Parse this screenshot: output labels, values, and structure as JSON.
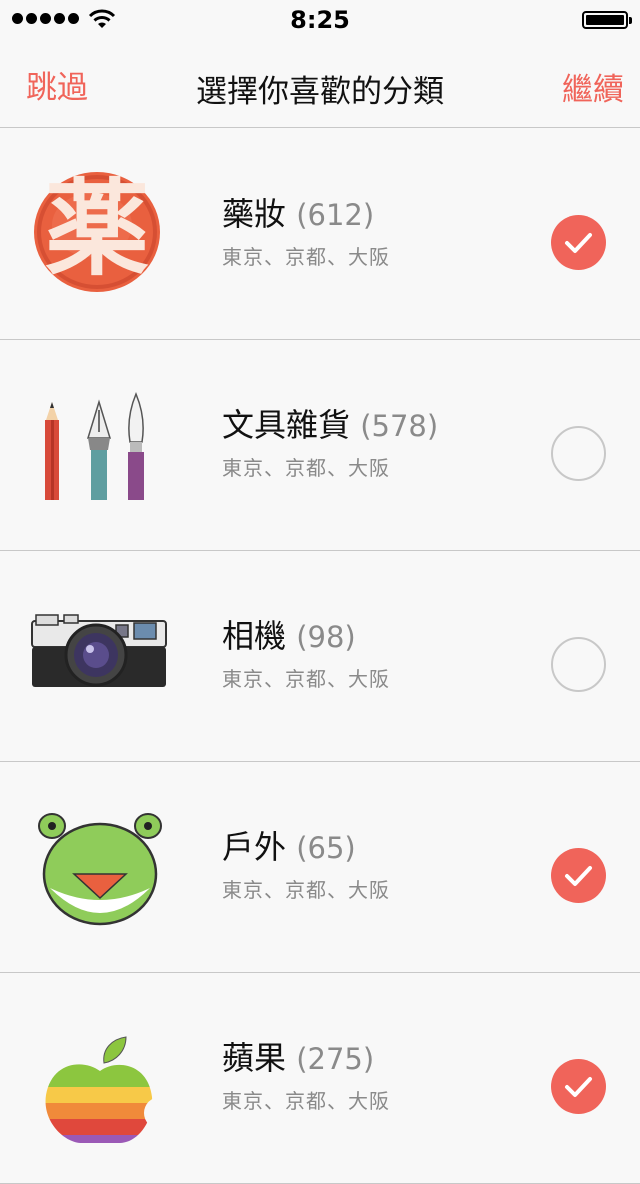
{
  "status_bar": {
    "time": "8:25"
  },
  "nav": {
    "skip": "跳過",
    "title": "選擇你喜歡的分類",
    "next": "繼續"
  },
  "categories": [
    {
      "name": "藥妝",
      "count": "(612)",
      "locations": "東京、京都、大阪",
      "selected": true,
      "icon": "medicine-stamp-icon",
      "stamp_char": "薬"
    },
    {
      "name": "文具雜貨",
      "count": "(578)",
      "locations": "東京、京都、大阪",
      "selected": false,
      "icon": "stationery-icon"
    },
    {
      "name": "相機",
      "count": "(98)",
      "locations": "東京、京都、大阪",
      "selected": false,
      "icon": "camera-icon"
    },
    {
      "name": "戶外",
      "count": "(65)",
      "locations": "東京、京都、大阪",
      "selected": true,
      "icon": "frog-icon"
    },
    {
      "name": "蘋果",
      "count": "(275)",
      "locations": "東京、京都、大阪",
      "selected": true,
      "icon": "rainbow-apple-icon"
    }
  ],
  "colors": {
    "accent": "#f0645a",
    "divider": "#c8c8c8",
    "muted_text": "#8a8a8a",
    "background": "#f8f8f8"
  }
}
